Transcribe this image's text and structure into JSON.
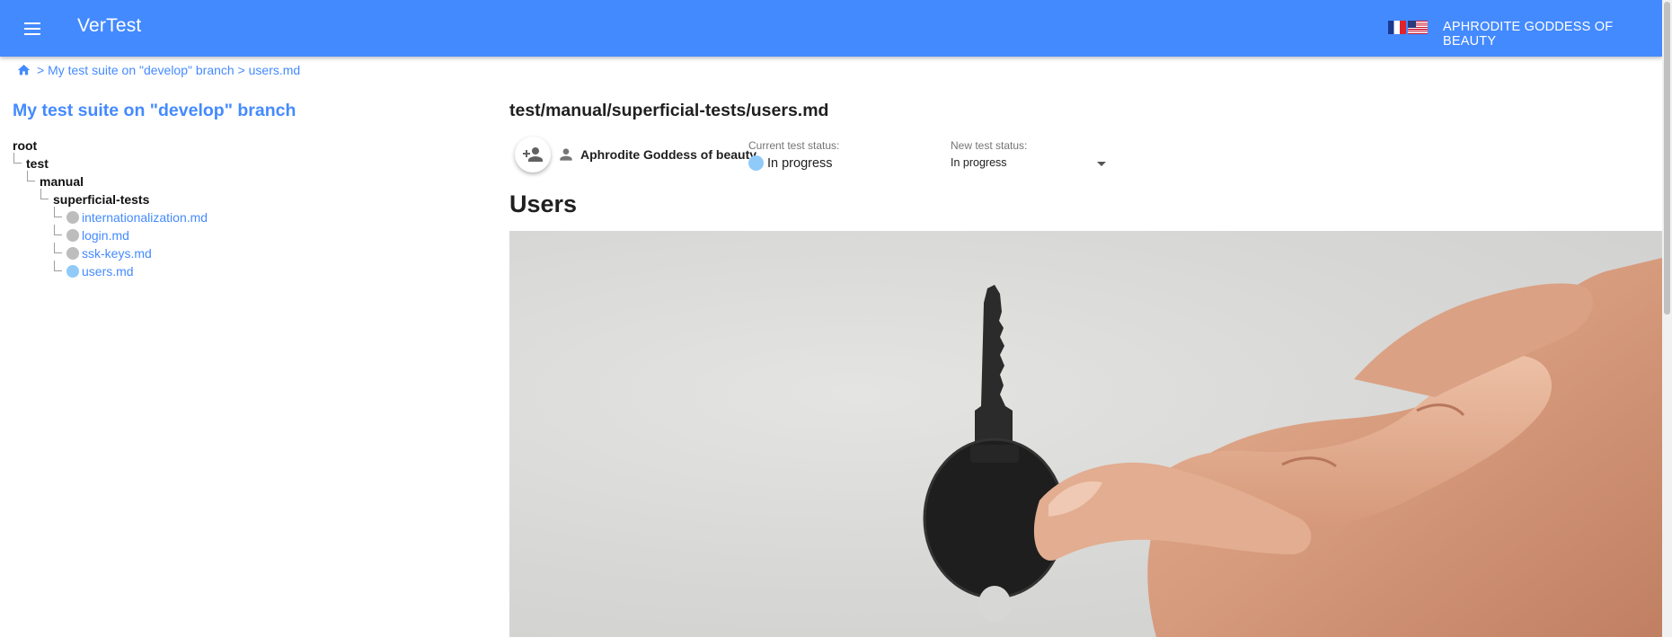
{
  "header": {
    "app_title": "VerTest",
    "user_name": "APHRODITE GODDESS OF BEAUTY",
    "icons": [
      "menu-icon",
      "flag-fr-icon",
      "flag-us-icon"
    ]
  },
  "breadcrumb": {
    "trail": "> My test suite on \"develop\" branch > users.md",
    "icons": [
      "home-icon"
    ]
  },
  "sidebar": {
    "suite_title": "My test suite on \"develop\" branch",
    "tree": {
      "root": "root",
      "test": "test",
      "manual": "manual",
      "superficial": "superficial-tests",
      "files": [
        "internationalization.md",
        "login.md",
        "ssk-keys.md",
        "users.md"
      ]
    }
  },
  "main": {
    "file_path": "test/manual/superficial-tests/users.md",
    "assignee": "Aphrodite Goddess of beauty",
    "current_status_label": "Current test status:",
    "current_status": "In progress",
    "new_status_label": "New test status:",
    "new_status_value": "In progress",
    "doc_heading": "Users",
    "image_subject": "hand holding a black key"
  },
  "colors": {
    "primary": "#448aff",
    "status_in_progress": "#90caf9",
    "status_untested": "#bdbdbd"
  }
}
